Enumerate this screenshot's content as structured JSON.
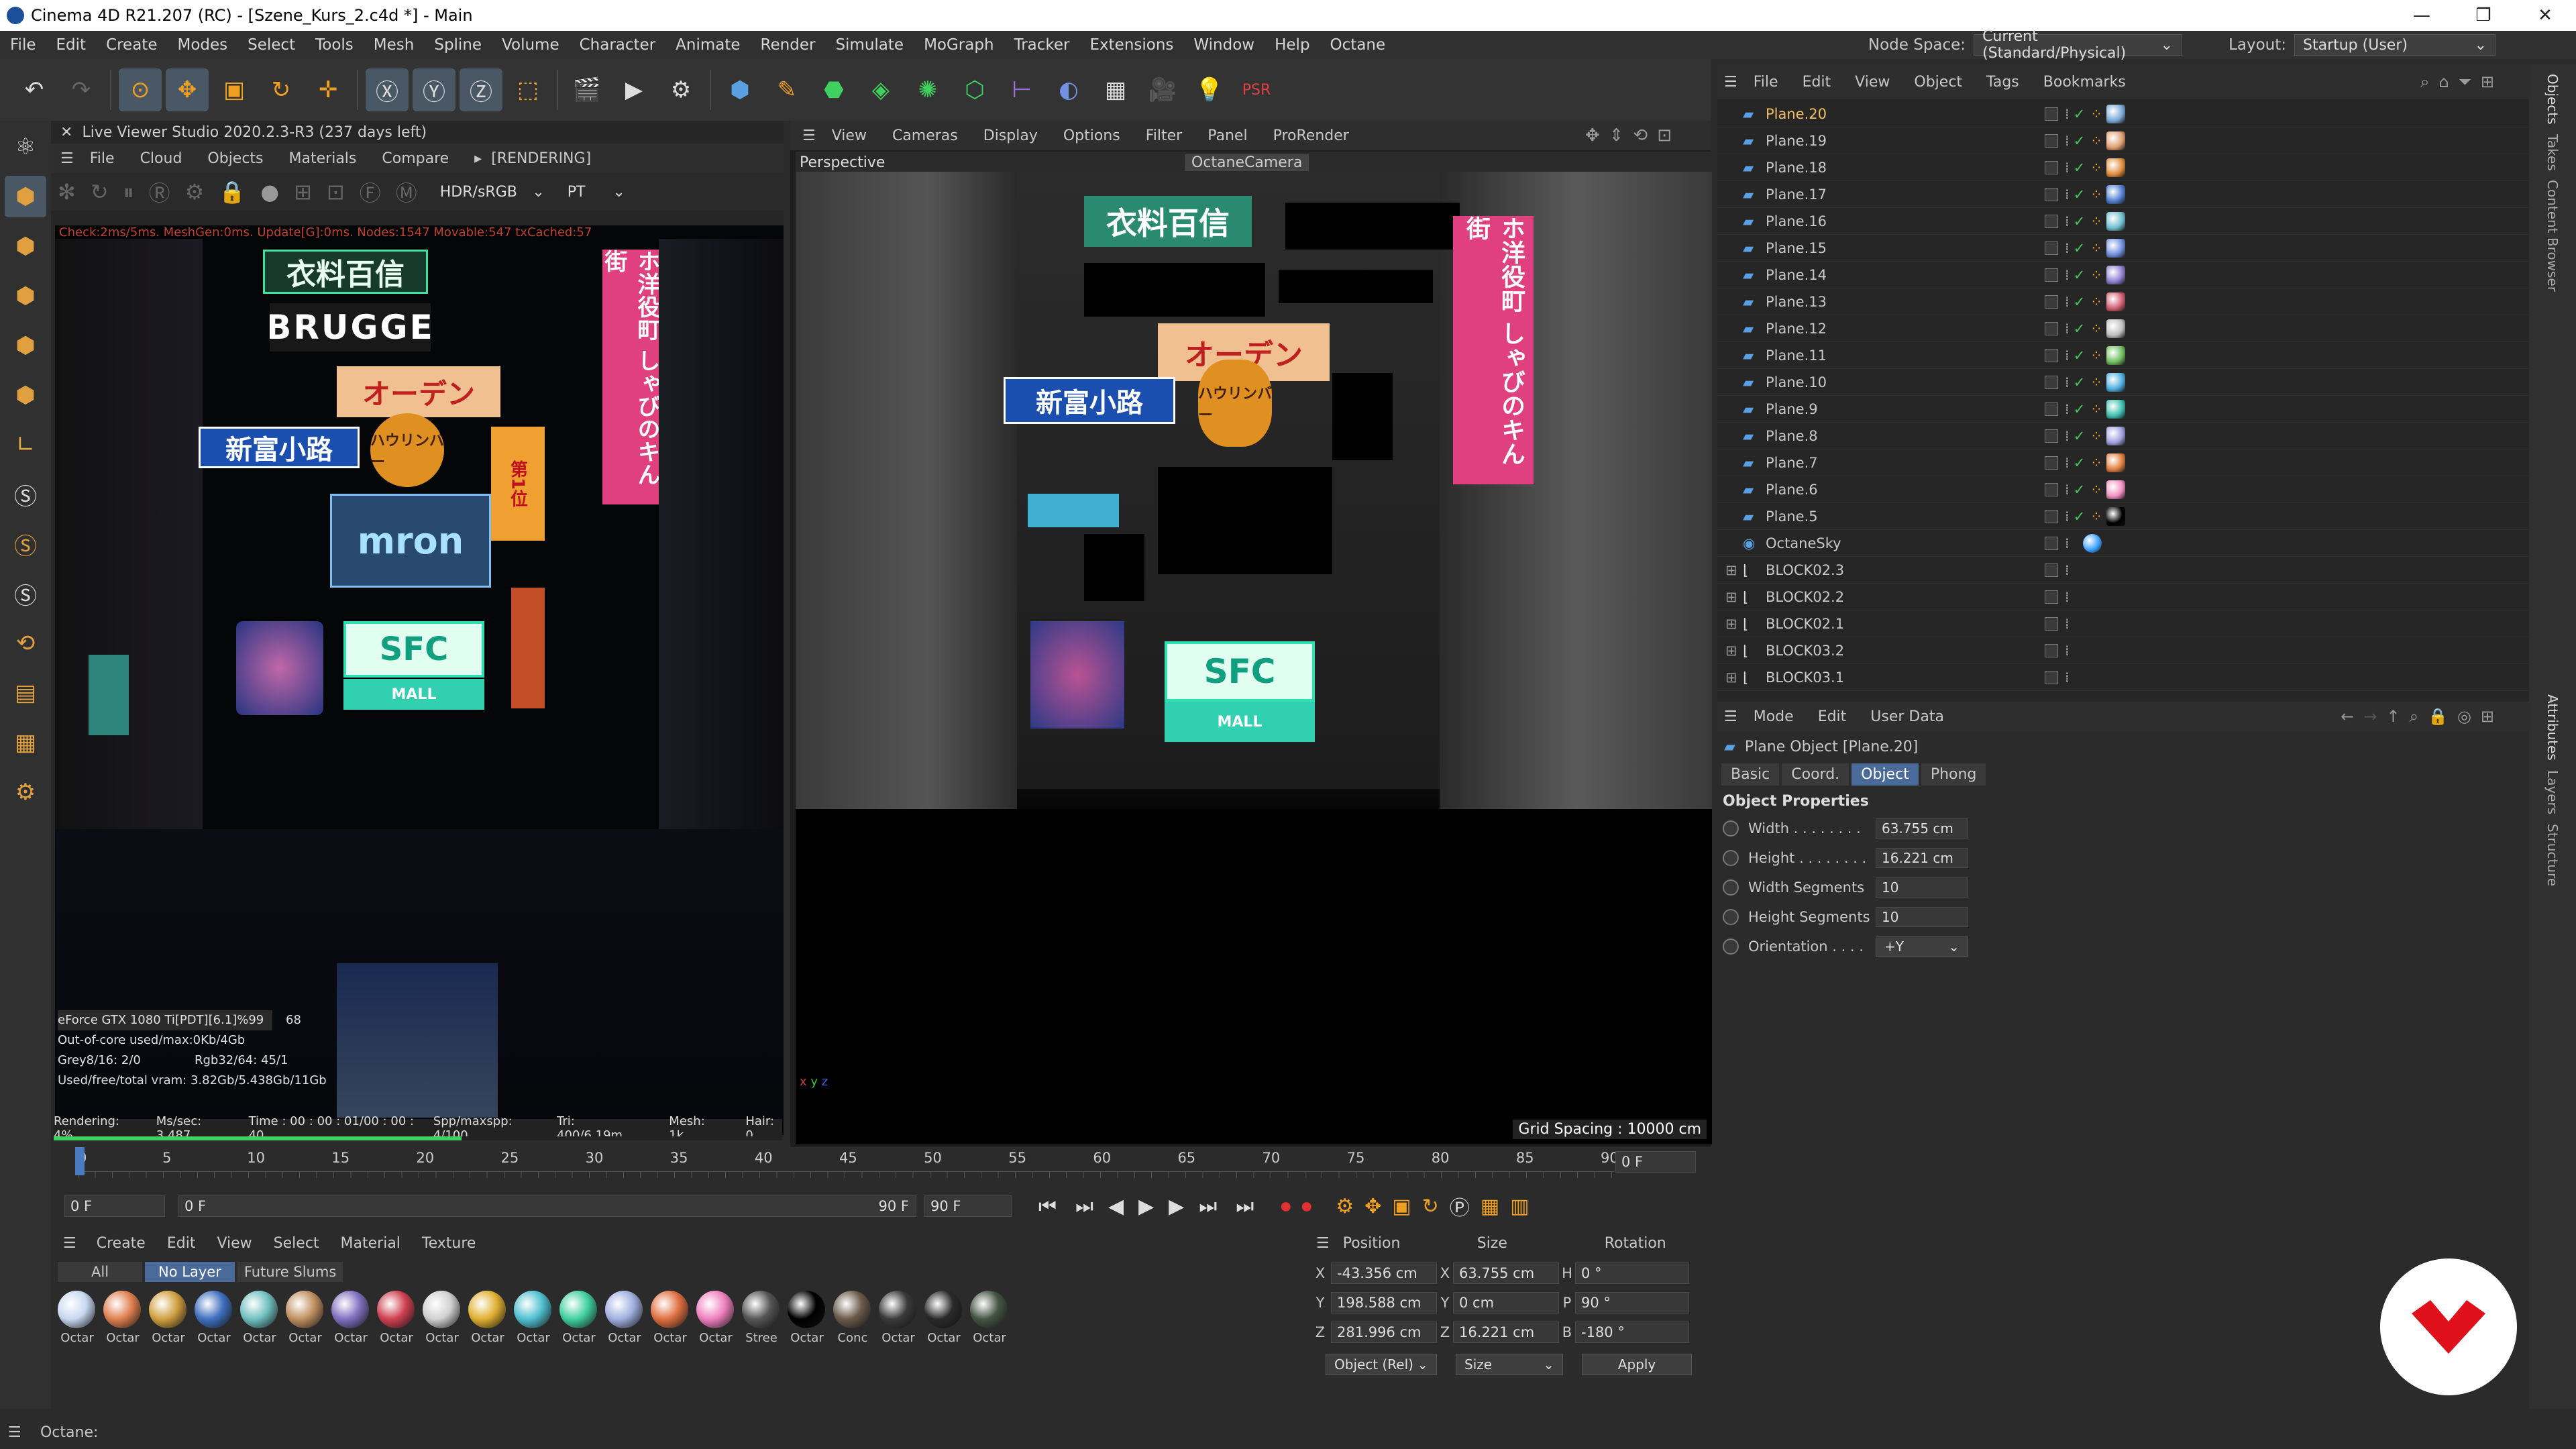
{
  "window": {
    "title": "Cinema 4D R21.207 (RC) - [Szene_Kurs_2.c4d *] - Main",
    "controls": [
      "—",
      "❐",
      "✕"
    ]
  },
  "menubar": {
    "items": [
      "File",
      "Edit",
      "Create",
      "Modes",
      "Select",
      "Tools",
      "Mesh",
      "Spline",
      "Volume",
      "Character",
      "Animate",
      "Render",
      "Simulate",
      "MoGraph",
      "Tracker",
      "Extensions",
      "Window",
      "Help",
      "Octane"
    ],
    "node_space_label": "Node Space:",
    "node_space_value": "Current (Standard/Physical)",
    "layout_label": "Layout:",
    "layout_value": "Startup (User)"
  },
  "live_viewer": {
    "title": "Live Viewer Studio 2020.2.3-R3 (237 days left)",
    "menu": [
      "File",
      "Cloud",
      "Objects",
      "Materials",
      "Compare"
    ],
    "rendering_tag": "[RENDERING]",
    "colorspace": "HDR/sRGB",
    "kernel": "PT",
    "check_line": "Check:2ms/5ms. MeshGen:0ms. Update[G]:0ms. Nodes:1547 Movable:547 txCached:57",
    "gpu": "eForce GTX 1080 Ti[PDT][6.1]%99",
    "gpu_temp": "68",
    "out_of_core": "Out-of-core used/max:0Kb/4Gb",
    "grey": "Grey8/16: 2/0",
    "rgb": "Rgb32/64: 45/1",
    "vram": "Used/free/total vram: 3.82Gb/5.438Gb/11Gb",
    "status": {
      "rendering": "Rendering: 4%",
      "ms": "Ms/sec: 3.487",
      "time": "Time : 00 : 00 : 01/00 : 00 : 40",
      "spp": "Spp/maxspp: 4/100",
      "tri": "Tri: 400/6.19m",
      "mesh": "Mesh: 1k",
      "hair": "Hair: 0"
    },
    "progress": 0.04,
    "signs": [
      "衣料百信",
      "BRUGGE",
      "オーデン",
      "新富小路",
      "ハウリンバー",
      "mron",
      "SFC",
      "MALL",
      "ホ洋役町 しゃびのキん街",
      "第1位"
    ]
  },
  "viewport": {
    "menu": [
      "View",
      "Cameras",
      "Display",
      "Options",
      "Filter",
      "Panel",
      "ProRender"
    ],
    "view_label": "Perspective",
    "camera_label": "OctaneCamera",
    "grid_spacing": "Grid Spacing : 10000 cm",
    "signs": [
      "衣料百信",
      "オーデン",
      "新富小路",
      "ハウリンバー",
      "SFC",
      "MALL",
      "ホ洋役町 しゃびのキん街"
    ]
  },
  "timeline": {
    "ticks": [
      "0",
      "5",
      "10",
      "15",
      "20",
      "25",
      "30",
      "35",
      "40",
      "45",
      "50",
      "55",
      "60",
      "65",
      "70",
      "75",
      "80",
      "85",
      "90"
    ],
    "current_frame": "0 F",
    "start": "0 F",
    "field_left": "0 F",
    "end_a": "90 F",
    "end_b": "90 F"
  },
  "materials": {
    "menu": [
      "Create",
      "Edit",
      "View",
      "Select",
      "Material",
      "Texture"
    ],
    "filters": [
      "All",
      "No Layer",
      "Future Slums"
    ],
    "active_filter": "No Layer",
    "items": [
      {
        "label": "Octar",
        "color": "#c8d8f0"
      },
      {
        "label": "Octar",
        "color": "#e08050"
      },
      {
        "label": "Octar",
        "color": "#d0a040"
      },
      {
        "label": "Octar",
        "color": "#4070c0"
      },
      {
        "label": "Octar",
        "color": "#70c0c0"
      },
      {
        "label": "Octar",
        "color": "#c09060"
      },
      {
        "label": "Octar",
        "color": "#8070c0"
      },
      {
        "label": "Octar",
        "color": "#d04050"
      },
      {
        "label": "Octar",
        "color": "#d0d0d0"
      },
      {
        "label": "Octar",
        "color": "#e0b030"
      },
      {
        "label": "Octar",
        "color": "#50c0d0"
      },
      {
        "label": "Octar",
        "color": "#40d0a0"
      },
      {
        "label": "Octar",
        "color": "#a0b0e0"
      },
      {
        "label": "Octar",
        "color": "#e07040"
      },
      {
        "label": "Octar",
        "color": "#f080c0"
      },
      {
        "label": "Stree",
        "color": "#555555"
      },
      {
        "label": "Octar",
        "color": "#000000"
      },
      {
        "label": "Conc",
        "color": "#6a5a4a"
      },
      {
        "label": "Octar",
        "color": "#3a3a3a"
      },
      {
        "label": "Octar",
        "color": "#2a2a2a"
      },
      {
        "label": "Octar",
        "color": "#445544"
      }
    ]
  },
  "coords": {
    "headers": [
      "Position",
      "Size",
      "Rotation"
    ],
    "rows": [
      {
        "axis": "X",
        "pos": "-43.356 cm",
        "size_axis": "X",
        "size": "63.755 cm",
        "rot_axis": "H",
        "rot": "0 °"
      },
      {
        "axis": "Y",
        "pos": "198.588 cm",
        "size_axis": "Y",
        "size": "0 cm",
        "rot_axis": "P",
        "rot": "90 °"
      },
      {
        "axis": "Z",
        "pos": "281.996 cm",
        "size_axis": "Z",
        "size": "16.221 cm",
        "rot_axis": "B",
        "rot": "-180 °"
      }
    ],
    "mode": "Object (Rel)",
    "size_mode": "Size",
    "apply": "Apply"
  },
  "object_manager": {
    "menu": [
      "File",
      "Edit",
      "View",
      "Object",
      "Tags",
      "Bookmarks"
    ],
    "objects": [
      {
        "name": "Plane.20",
        "selected": true,
        "tag": "#7aa8d8"
      },
      {
        "name": "Plane.19",
        "tag": "#e0a070"
      },
      {
        "name": "Plane.18",
        "tag": "#e09040"
      },
      {
        "name": "Plane.17",
        "tag": "#5080d0"
      },
      {
        "name": "Plane.16",
        "tag": "#70c0d0"
      },
      {
        "name": "Plane.15",
        "tag": "#7090e0"
      },
      {
        "name": "Plane.14",
        "tag": "#9080d0"
      },
      {
        "name": "Plane.13",
        "tag": "#d06070"
      },
      {
        "name": "Plane.12",
        "tag": "#c0c0c0"
      },
      {
        "name": "Plane.11",
        "tag": "#70c060"
      },
      {
        "name": "Plane.10",
        "tag": "#50b0e0"
      },
      {
        "name": "Plane.9",
        "tag": "#40c0b0"
      },
      {
        "name": "Plane.8",
        "tag": "#a0a0e0"
      },
      {
        "name": "Plane.7",
        "tag": "#e08040"
      },
      {
        "name": "Plane.6",
        "tag": "#f090c0"
      },
      {
        "name": "Plane.5",
        "tag": "#000000"
      },
      {
        "name": "OctaneSky",
        "tag": "#3aa0ff"
      },
      {
        "name": "BLOCK02.3",
        "group": true
      },
      {
        "name": "BLOCK02.2",
        "group": true
      },
      {
        "name": "BLOCK02.1",
        "group": true
      },
      {
        "name": "BLOCK03.2",
        "group": true
      },
      {
        "name": "BLOCK03.1",
        "group": true
      }
    ]
  },
  "attributes": {
    "menu": [
      "Mode",
      "Edit",
      "User Data"
    ],
    "object_title": "Plane Object [Plane.20]",
    "tabs": [
      "Basic",
      "Coord.",
      "Object",
      "Phong"
    ],
    "active_tab": "Object",
    "section": "Object Properties",
    "props": [
      {
        "label": "Width . . . . . . . .",
        "value": "63.755 cm"
      },
      {
        "label": "Height . . . . . . . .",
        "value": "16.221 cm"
      },
      {
        "label": "Width Segments",
        "value": "10"
      },
      {
        "label": "Height Segments",
        "value": "10"
      },
      {
        "label": "Orientation . . . .",
        "value": "+Y"
      }
    ]
  },
  "right_tabs": [
    "Objects",
    "Takes",
    "Content Browser",
    "Attributes",
    "Layers",
    "Structure"
  ],
  "statusbar": {
    "text": "Octane:"
  },
  "colors": {
    "accent": "#4a6a9a",
    "selected_text": "#f0c060",
    "logo_red": "#e0101a"
  }
}
